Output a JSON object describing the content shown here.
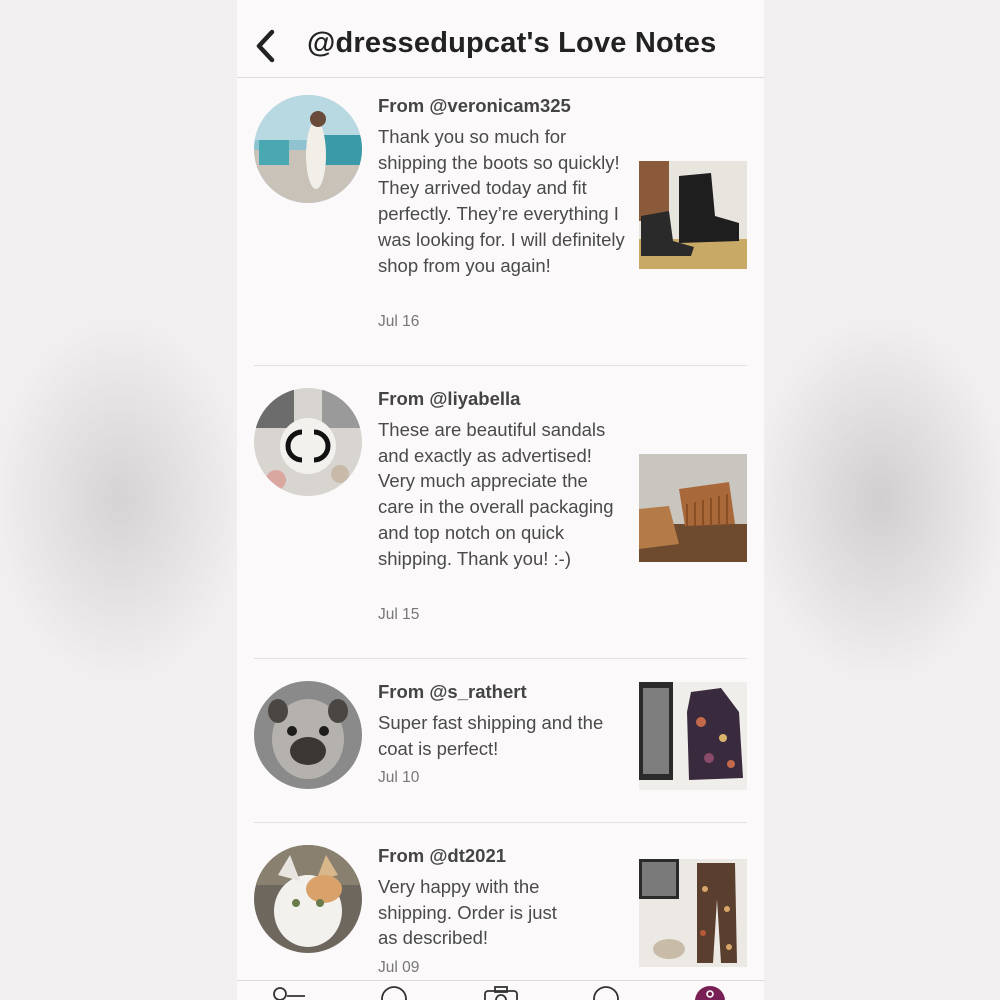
{
  "header": {
    "title": "@dressedupcat's Love Notes",
    "back_icon": "chevron-left-icon"
  },
  "notes": [
    {
      "from": "From @veronicam325",
      "message": "Thank you so much for shipping the boots so quickly! They arrived today and fit perfectly. They’re everything I was looking for. I will definitely shop from you again!",
      "date": "Jul 16"
    },
    {
      "from": "From @liyabella",
      "message": "These are beautiful sandals and exactly as advertised! Very much appreciate the care in the overall packaging and top notch on quick shipping. Thank you! :-)",
      "date": "Jul 15"
    },
    {
      "from": "From @s_rathert",
      "message": "Super fast shipping and the coat is perfect!",
      "date": "Jul 10"
    },
    {
      "from": "From @dt2021",
      "message": "Very happy with the shipping. Order is just as described!",
      "date": "Jul 09"
    }
  ],
  "tabbar": {
    "icons": [
      "feed-icon",
      "search-icon",
      "camera-icon",
      "news-icon",
      "profile-icon"
    ],
    "active_color": "#7a1f55"
  }
}
